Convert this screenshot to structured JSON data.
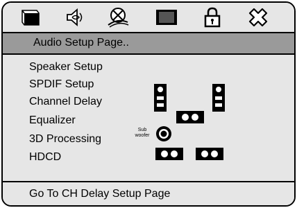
{
  "top_bar": {
    "icons": [
      "general-setup-icon",
      "audio-setup-icon",
      "dolby-digital-icon",
      "video-setup-icon",
      "password-lock-icon",
      "exit-icon"
    ]
  },
  "title_bar": {
    "title": "Audio Setup Page.."
  },
  "menu": {
    "items": [
      {
        "label": "Speaker Setup"
      },
      {
        "label": "SPDIF Setup"
      },
      {
        "label": "Channel Delay"
      },
      {
        "label": "Equalizer"
      },
      {
        "label": "3D Processing"
      },
      {
        "label": "HDCD"
      }
    ]
  },
  "speaker_diagram": {
    "subwoofer_label_line1": "Sub",
    "subwoofer_label_line2": "woofer"
  },
  "status_bar": {
    "text": "Go To CH Delay Setup Page"
  }
}
